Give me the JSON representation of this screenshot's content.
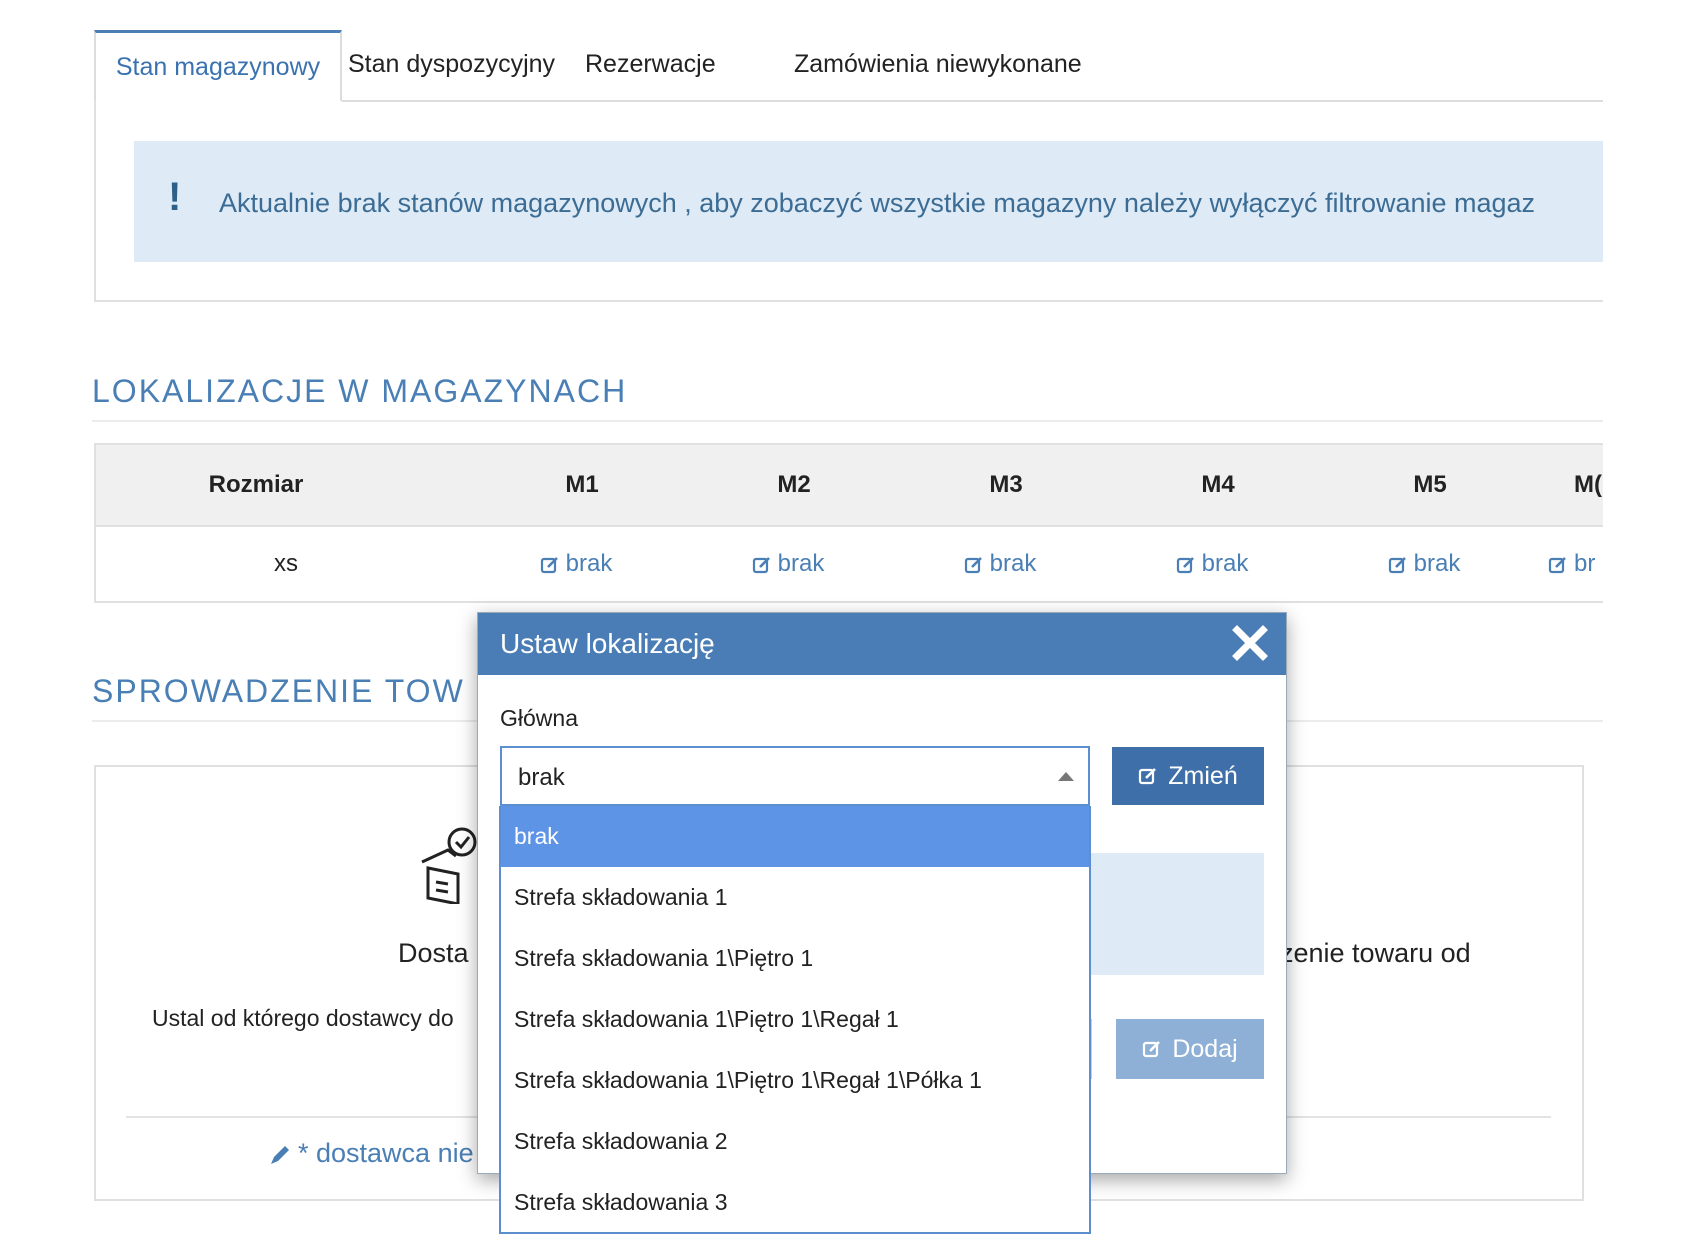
{
  "tabs": [
    {
      "label": "Stan magazynowy",
      "active": true
    },
    {
      "label": "Stan dyspozycyjny",
      "active": false
    },
    {
      "label": "Rezerwacje",
      "active": false
    },
    {
      "label": "Zamówienia niewykonane",
      "active": false
    }
  ],
  "alert": {
    "icon": "exclamation-icon",
    "text": "Aktualnie brak stanów magazynowych , aby zobaczyć wszystkie magazyny należy wyłączyć filtrowanie magaz"
  },
  "locations_section": {
    "title": "LOKALIZACJE W MAGAZYNACH",
    "table": {
      "headers": [
        "Rozmiar",
        "M1",
        "M2",
        "M3",
        "M4",
        "M5",
        "M("
      ],
      "row": {
        "size": "xs",
        "cells": [
          "brak",
          "brak",
          "brak",
          "brak",
          "brak",
          "br"
        ]
      }
    }
  },
  "check_section": {
    "title": "SPROWADZENIE TOW",
    "card": {
      "text_left": "Dosta",
      "text_right": "zenie towaru od",
      "subtext": "Ustal od którego dostawcy do",
      "link": "* dostawca nie"
    }
  },
  "modal": {
    "title": "Ustaw lokalizację",
    "field_label": "Główna",
    "select_value": "brak",
    "change_button": "Zmień",
    "add_button": "Dodaj"
  },
  "dropdown": {
    "options": [
      "brak",
      "Strefa składowania 1",
      "Strefa składowania 1\\Piętro 1",
      "Strefa składowania 1\\Piętro 1\\Regał 1",
      "Strefa składowania 1\\Piętro 1\\Regał 1\\Półka 1",
      "Strefa składowania 2",
      "Strefa składowania 3"
    ],
    "selected_index": 0
  },
  "colors": {
    "accent": "#4a7fb5",
    "modal_header": "#4a7db5",
    "alert_bg": "#deebf6",
    "selected_option": "#5e94e6"
  }
}
